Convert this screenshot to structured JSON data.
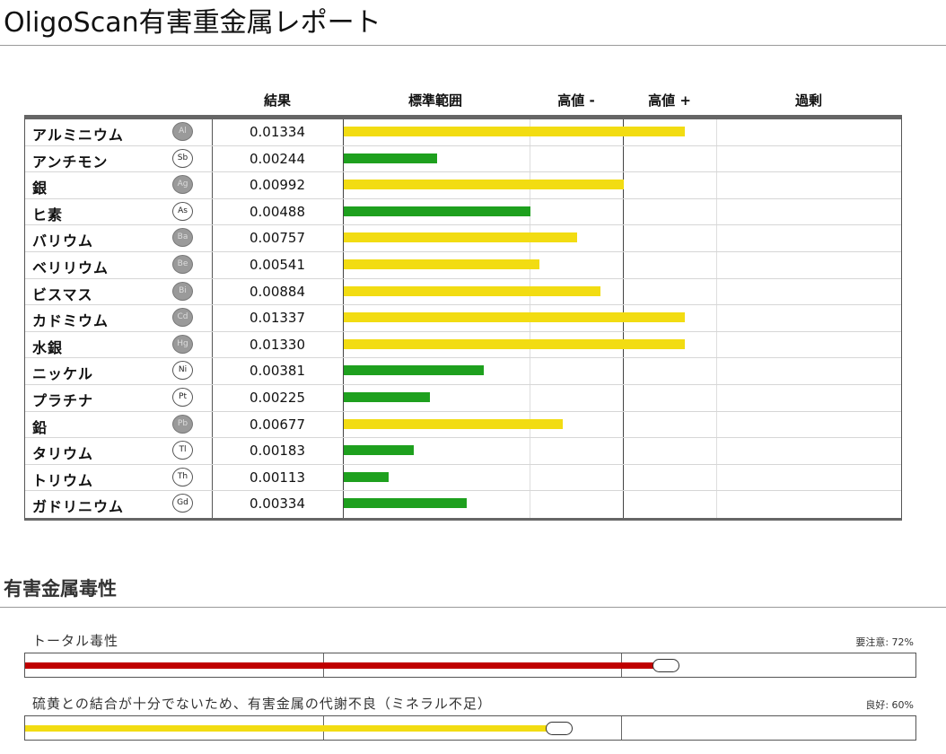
{
  "page": {
    "title": "OligoScan有害重金属レポート"
  },
  "table": {
    "headers": {
      "result": "結果",
      "standard": "標準範囲",
      "high_minus": "高値 -",
      "high_plus": "高値 +",
      "excess": "過剰"
    }
  },
  "chart_data": {
    "type": "bar",
    "orientation": "horizontal",
    "title": "OligoScan有害重金属レポート",
    "zones": [
      "標準範囲",
      "高値 -",
      "高値 +",
      "過剰"
    ],
    "colors": {
      "normal": "#1ea01e",
      "elevated": "#f2dc12",
      "good": "#1ea01e"
    },
    "categories": [
      "アルミニウム",
      "アンチモン",
      "銀",
      "ヒ素",
      "バリウム",
      "ベリリウム",
      "ビスマス",
      "カドミウム",
      "水銀",
      "ニッケル",
      "プラチナ",
      "鉛",
      "タリウム",
      "トリウム",
      "ガドリニウム"
    ],
    "symbols": [
      "Al",
      "Sb",
      "Ag",
      "As",
      "Ba",
      "Be",
      "Bi",
      "Cd",
      "Hg",
      "Ni",
      "Pt",
      "Pb",
      "Tl",
      "Th",
      "Gd"
    ],
    "values": [
      "0.01334",
      "0.00244",
      "0.00992",
      "0.00488",
      "0.00757",
      "0.00541",
      "0.00884",
      "0.01337",
      "0.01330",
      "0.00381",
      "0.00225",
      "0.00677",
      "0.00183",
      "0.00113",
      "0.00334"
    ],
    "level": [
      3.65,
      1.0,
      3.0,
      2.0,
      2.5,
      2.1,
      2.75,
      3.65,
      3.65,
      1.5,
      0.92,
      2.35,
      0.75,
      0.48,
      1.32
    ],
    "bar_color": [
      "elevated",
      "normal",
      "elevated",
      "normal",
      "elevated",
      "elevated",
      "elevated",
      "elevated",
      "elevated",
      "normal",
      "normal",
      "elevated",
      "normal",
      "normal",
      "normal"
    ],
    "symbol_filled": [
      true,
      false,
      true,
      false,
      true,
      true,
      true,
      true,
      true,
      false,
      false,
      true,
      false,
      false,
      false
    ]
  },
  "toxicity": {
    "section_title": "有害金属毒性",
    "items": [
      {
        "label": "トータル毒性",
        "status": "要注意: 72%",
        "percent": 72,
        "color": "#c00000"
      },
      {
        "label": "硫黄との結合が十分でないため、有害金属の代謝不良（ミネラル不足）",
        "status": "良好: 60%",
        "percent": 60,
        "color": "#f2dc12"
      }
    ]
  }
}
